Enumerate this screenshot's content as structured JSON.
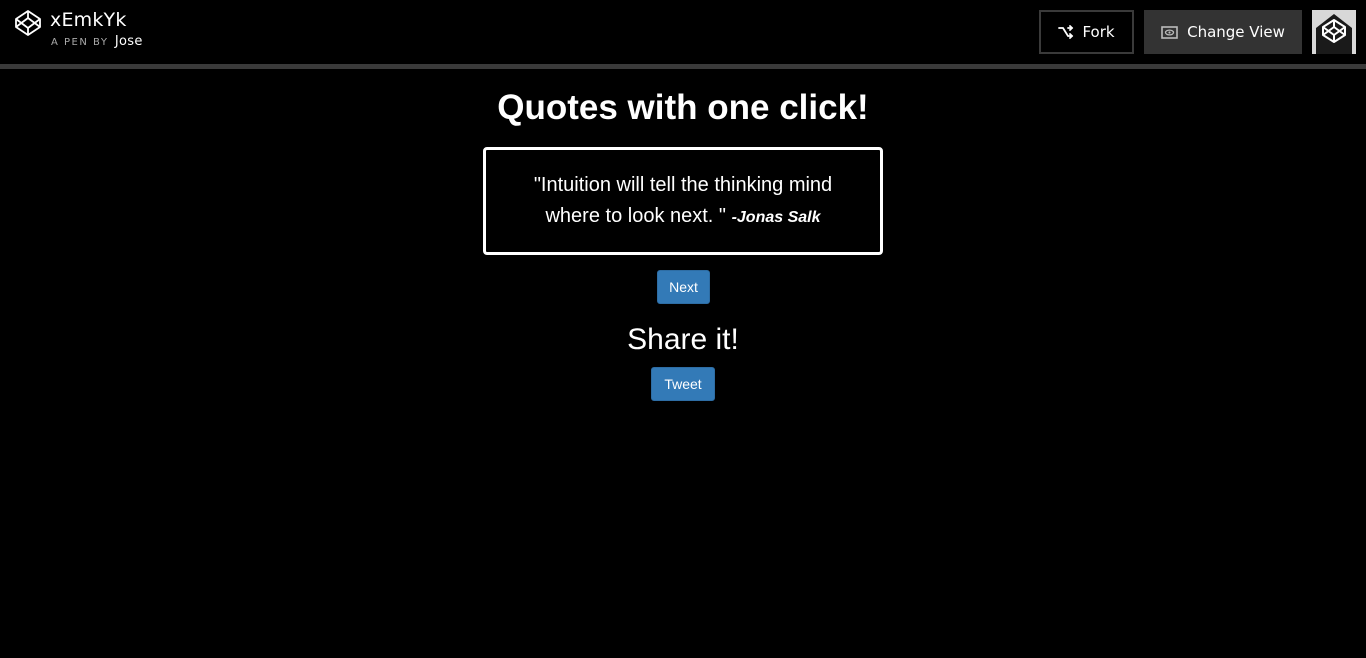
{
  "header": {
    "pen_title": "xEmkYk",
    "pen_by_label": "A PEN BY",
    "author": "Jose",
    "fork_label": "Fork",
    "change_view_label": "Change View"
  },
  "main": {
    "title": "Quotes with one click!",
    "quote": {
      "text": "\"Intuition will tell the thinking mind where to look next. \"",
      "author": "-Jonas Salk"
    },
    "next_label": "Next",
    "share_heading": "Share it!",
    "tweet_label": "Tweet"
  },
  "colors": {
    "background": "#000000",
    "button_primary": "#337ab7",
    "topbar_divider": "#3a3a3a",
    "change_view_bg": "#333333"
  },
  "icons": {
    "logo": "codepen-logo-icon",
    "fork": "fork-icon",
    "change_view": "eye-icon",
    "avatar": "codepen-avatar-icon"
  }
}
